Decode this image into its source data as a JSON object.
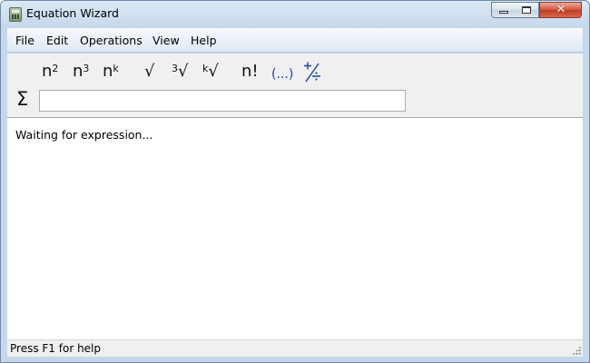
{
  "window": {
    "title": "Equation Wizard",
    "close_glyph": "✕"
  },
  "menubar": {
    "items": [
      "File",
      "Edit",
      "Operations",
      "View",
      "Help"
    ]
  },
  "toolbar": {
    "square": {
      "base": "n",
      "exp": "2"
    },
    "cube": {
      "base": "n",
      "exp": "3"
    },
    "power": {
      "base": "n",
      "exp": "k"
    },
    "sqrt": {
      "symbol": "√"
    },
    "cube_root": {
      "index": "3",
      "symbol": "√"
    },
    "kth_root": {
      "index": "k",
      "symbol": "√"
    },
    "factorial": {
      "label": "n!"
    },
    "parentheses": {
      "label": "(...)"
    },
    "fraction_icon": "plus-over-divide-icon"
  },
  "expression": {
    "sigma": "Σ",
    "value": "",
    "placeholder": ""
  },
  "content": {
    "message": "Waiting for expression..."
  },
  "statusbar": {
    "text": "Press F1 for help"
  },
  "colors": {
    "accent_blue": "#1a3fb0",
    "title_gradient_top": "#dce8f5",
    "close_red": "#c03a22"
  }
}
